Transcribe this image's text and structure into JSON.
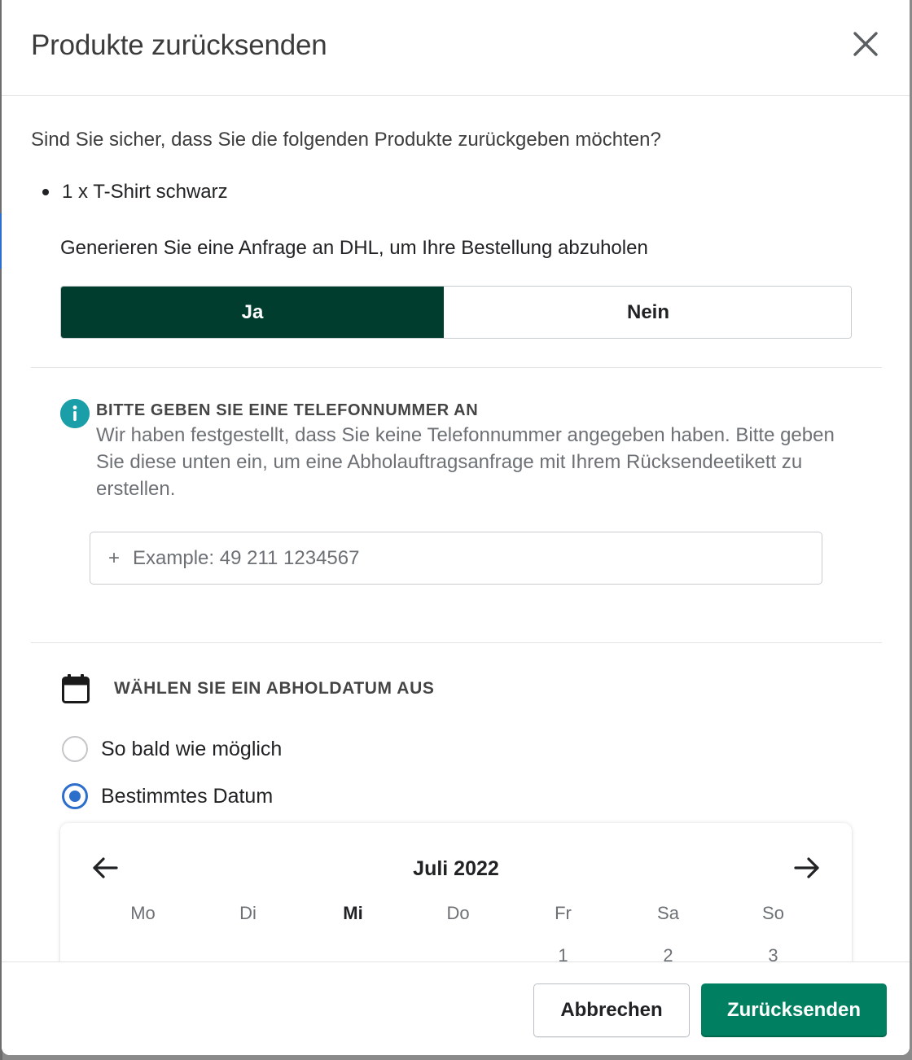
{
  "dialog": {
    "title": "Produkte zurücksenden",
    "question": "Sind Sie sicher, dass Sie die folgenden Produkte zurückgeben möchten?",
    "items": [
      "1 x T-Shirt schwarz"
    ],
    "dhl_label": "Generieren Sie eine Anfrage an DHL, um Ihre Bestellung abzuholen",
    "toggle": {
      "yes": "Ja",
      "no": "Nein",
      "selected": "Ja"
    }
  },
  "phone_notice": {
    "title": "BITTE GEBEN SIE EINE TELEFONNUMMER AN",
    "text": "Wir haben festgestellt, dass Sie keine Telefonnummer angegeben haben. Bitte geben Sie diese unten ein, um eine Abholauftragsanfrage mit Ihrem Rücksendeetikett zu erstellen.",
    "prefix": "+",
    "placeholder": "Example: 49 211 1234567",
    "value": ""
  },
  "pickup": {
    "title": "WÄHLEN SIE EIN ABHOLDATUM AUS",
    "options": [
      {
        "label": "So bald wie möglich",
        "checked": false
      },
      {
        "label": "Bestimmtes Datum",
        "checked": true
      }
    ]
  },
  "calendar": {
    "month": "Juli 2022",
    "weekdays": [
      "Mo",
      "Di",
      "Mi",
      "Do",
      "Fr",
      "Sa",
      "So"
    ],
    "highlighted_weekday": "Mi",
    "first_row": [
      "",
      "",
      "",
      "",
      "1",
      "2",
      "3"
    ]
  },
  "footer": {
    "cancel": "Abbrechen",
    "submit": "Zurücksenden"
  },
  "colors": {
    "toggle_selected": "#003d2e",
    "primary": "#008060",
    "radio": "#2c6ecb",
    "info": "#1a9fa8"
  },
  "icons": [
    "close-icon",
    "info-icon",
    "calendar-icon",
    "arrow-left-icon",
    "arrow-right-icon"
  ]
}
